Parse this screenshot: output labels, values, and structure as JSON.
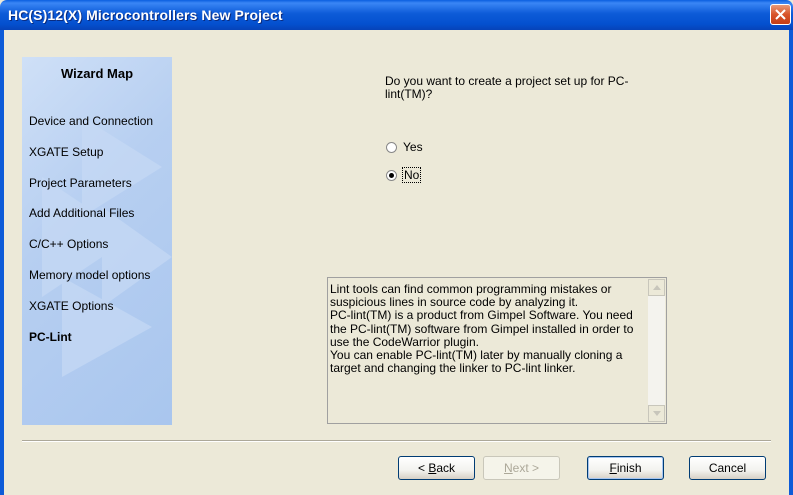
{
  "window": {
    "title": "HC(S)12(X) Microcontrollers New Project"
  },
  "wizard_map": {
    "heading": "Wizard Map",
    "items": [
      {
        "label": "Device and Connection",
        "active": false
      },
      {
        "label": "XGATE Setup",
        "active": false
      },
      {
        "label": "Project Parameters",
        "active": false
      },
      {
        "label": "Add Additional Files",
        "active": false
      },
      {
        "label": "C/C++ Options",
        "active": false
      },
      {
        "label": "Memory model options",
        "active": false
      },
      {
        "label": "XGATE Options",
        "active": false
      },
      {
        "label": "PC-Lint",
        "active": true
      }
    ]
  },
  "main": {
    "question": "Do you want to create a project set up for PC-lint(TM)?",
    "options": [
      {
        "label": "Yes",
        "selected": false
      },
      {
        "label": "No",
        "selected": true
      }
    ],
    "info_text": "Lint tools can find common programming mistakes or suspicious lines in source code by analyzing it.\nPC-lint(TM) is a product from Gimpel Software. You need the PC-lint(TM) software from Gimpel installed in order to use the CodeWarrior plugin.\nYou can enable PC-lint(TM) later by manually cloning a target and changing the linker to PC-lint linker."
  },
  "buttons": {
    "back": {
      "prefix": "< ",
      "mnemonic": "B",
      "rest": "ack"
    },
    "next": {
      "mnemonic": "N",
      "rest": "ext >"
    },
    "finish": {
      "mnemonic": "F",
      "rest": "inish"
    },
    "cancel": "Cancel"
  },
  "colors": {
    "titlebar": "#0d5bd8",
    "panel": "#b7cff1",
    "dialog_bg": "#ece9d8"
  }
}
